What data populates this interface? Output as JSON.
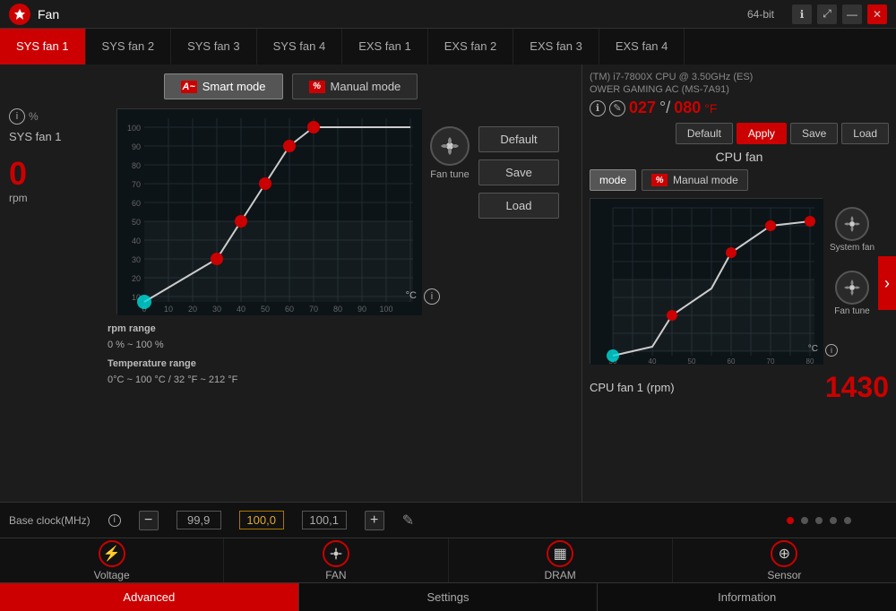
{
  "titlebar": {
    "logo": "★",
    "title": "Fan",
    "right_info": "64-bit",
    "close": "✕",
    "minimize": "—",
    "maximize": "⤢"
  },
  "cpu_info": {
    "name": "(TM) i7-7800X CPU @ 3.50GHz (ES)",
    "board": "OWER GAMING AC (MS-7A91)"
  },
  "temp_display": {
    "celsius": "027",
    "fahrenheit": "080"
  },
  "tabs": [
    {
      "label": "SYS fan 1",
      "active": true
    },
    {
      "label": "SYS fan 2"
    },
    {
      "label": "SYS fan 3"
    },
    {
      "label": "SYS fan 4"
    },
    {
      "label": "EXS fan 1"
    },
    {
      "label": "EXS fan 2"
    },
    {
      "label": "EXS fan 3"
    },
    {
      "label": "EXS fan 4"
    }
  ],
  "modes": {
    "smart": "Smart mode",
    "manual": "Manual mode"
  },
  "fan": {
    "name": "SYS fan 1",
    "rpm": "0",
    "rpm_unit": "rpm",
    "percent_label": "%"
  },
  "chart": {
    "y_max": 100,
    "y_label": "%",
    "x_label": "°C",
    "x_ticks": [
      "0",
      "10",
      "20",
      "30",
      "40",
      "50",
      "60",
      "70",
      "80",
      "90",
      "100"
    ],
    "y_ticks": [
      "100",
      "90",
      "80",
      "70",
      "60",
      "50",
      "40",
      "30",
      "20",
      "10",
      "0"
    ]
  },
  "fan_tune": "Fan tune",
  "system_fan": "System fan",
  "chart_buttons": {
    "default": "Default",
    "save": "Save",
    "load": "Load"
  },
  "range_info": {
    "rpm_range_label": "rpm range",
    "rpm_range_value": "0 % ~ 100 %",
    "temp_range_label": "Temperature range",
    "temp_range_value": "0°C ~ 100 °C / 32 °F ~ 212 °F"
  },
  "right_panel": {
    "cpu_fan_title": "CPU fan",
    "mode_label": "mode",
    "manual_mode": "Manual mode",
    "action_buttons": {
      "default": "Default",
      "apply": "Apply",
      "save": "Save",
      "load": "Load"
    },
    "cpu_fan_rpm_label": "CPU fan 1 (rpm)",
    "cpu_fan_rpm": "1430"
  },
  "bottom_bar": {
    "base_clock_label": "Base clock(MHz)",
    "value1": "99,9",
    "value2": "100,0",
    "value3": "100,1",
    "minus": "−",
    "plus": "+"
  },
  "pagination": {
    "dots": 5,
    "active": 0
  },
  "nav_items": [
    {
      "label": "Voltage",
      "icon": "⚡"
    },
    {
      "label": "FAN",
      "icon": "◎"
    },
    {
      "label": "DRAM",
      "icon": "▦"
    },
    {
      "label": "Sensor",
      "icon": "⊕"
    }
  ],
  "footer_buttons": [
    {
      "label": "Advanced",
      "active": true
    },
    {
      "label": "Settings",
      "active": false
    },
    {
      "label": "Information",
      "active": false
    }
  ]
}
